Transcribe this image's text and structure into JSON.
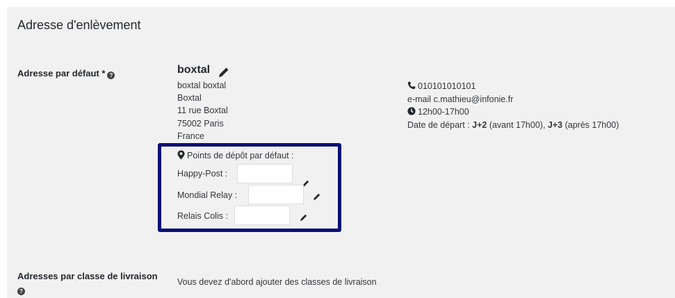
{
  "section_title": "Adresse d'enlèvement",
  "default_address": {
    "label": "Adresse par défaut *",
    "name": "boxtal",
    "lines": [
      "boxtal boxtal",
      "Boxtal",
      "11 rue Boxtal",
      "75002 Paris",
      "France"
    ]
  },
  "contact": {
    "phone": "010101010101",
    "email_prefix": "e-mail",
    "email": "c.mathieu@infonie.fr",
    "hours": "12h00-17h00",
    "departure_label": "Date de départ : ",
    "j2": "J+2",
    "j2_note": " (avant 17h00), ",
    "j3": "J+3",
    "j3_note": " (après 17h00)"
  },
  "depot": {
    "title": "Points de dépôt par défaut :",
    "rows": [
      {
        "label": "Happy-Post :",
        "value": ""
      },
      {
        "label": "Mondial Relay :",
        "value": ""
      },
      {
        "label": "Relais Colis :",
        "value": ""
      }
    ]
  },
  "classes": {
    "label": "Adresses par classe de livraison",
    "text": "Vous devez d'abord ajouter des classes de livraison"
  },
  "colors": {
    "highlight_border": "#0b0f76",
    "panel_bg": "#f1f1f1"
  }
}
